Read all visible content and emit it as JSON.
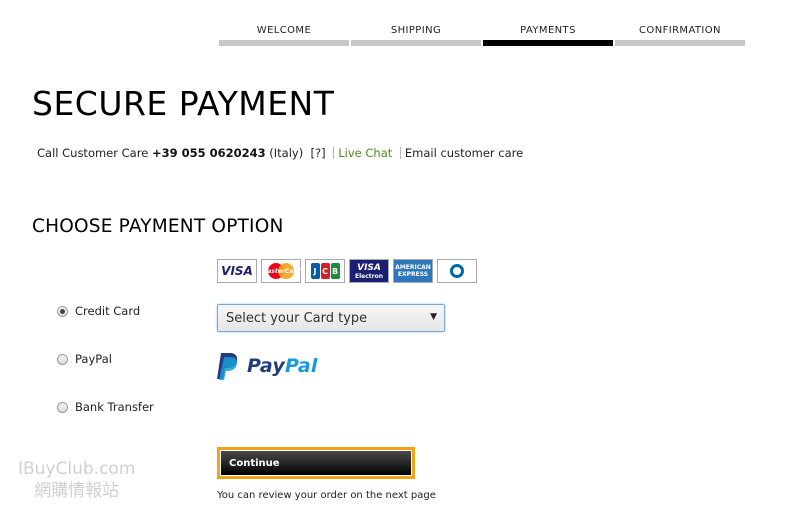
{
  "steps": [
    {
      "label": "WELCOME",
      "active": false
    },
    {
      "label": "SHIPPING",
      "active": false
    },
    {
      "label": "PAYMENTS",
      "active": true
    },
    {
      "label": "CONFIRMATION",
      "active": false
    }
  ],
  "page_title": "SECURE PAYMENT",
  "customer_care": {
    "prefix": "Call Customer Care",
    "phone": "+39 055 0620243",
    "country": "(Italy)",
    "help": "[?]",
    "live_chat": "Live Chat",
    "email": "Email customer care"
  },
  "section_title": "CHOOSE PAYMENT OPTION",
  "card_logos": {
    "visa": "VISA",
    "mastercard": "MasterCard",
    "jcb": [
      "J",
      "C",
      "B"
    ],
    "visa_electron_top": "VISA",
    "visa_electron_bottom": "Electron",
    "amex_top": "AMERICAN",
    "amex_bottom": "EXPRESS"
  },
  "payment_options": [
    {
      "label": "Credit Card",
      "checked": true
    },
    {
      "label": "PayPal",
      "checked": false
    },
    {
      "label": "Bank Transfer",
      "checked": false
    }
  ],
  "card_select": {
    "value": "Select your Card type"
  },
  "paypal_logo": {
    "pay": "Pay",
    "pal": "Pal"
  },
  "continue_label": "Continue",
  "review_note": "You can review your order on the next page",
  "watermark": {
    "line1": "IBuyClub.com",
    "line2": "網購情報站"
  },
  "colors": {
    "accent_orange": "#f3a317",
    "chat_green": "#4a8a1f",
    "paypal_dark": "#253b80",
    "paypal_light": "#179bd7"
  }
}
